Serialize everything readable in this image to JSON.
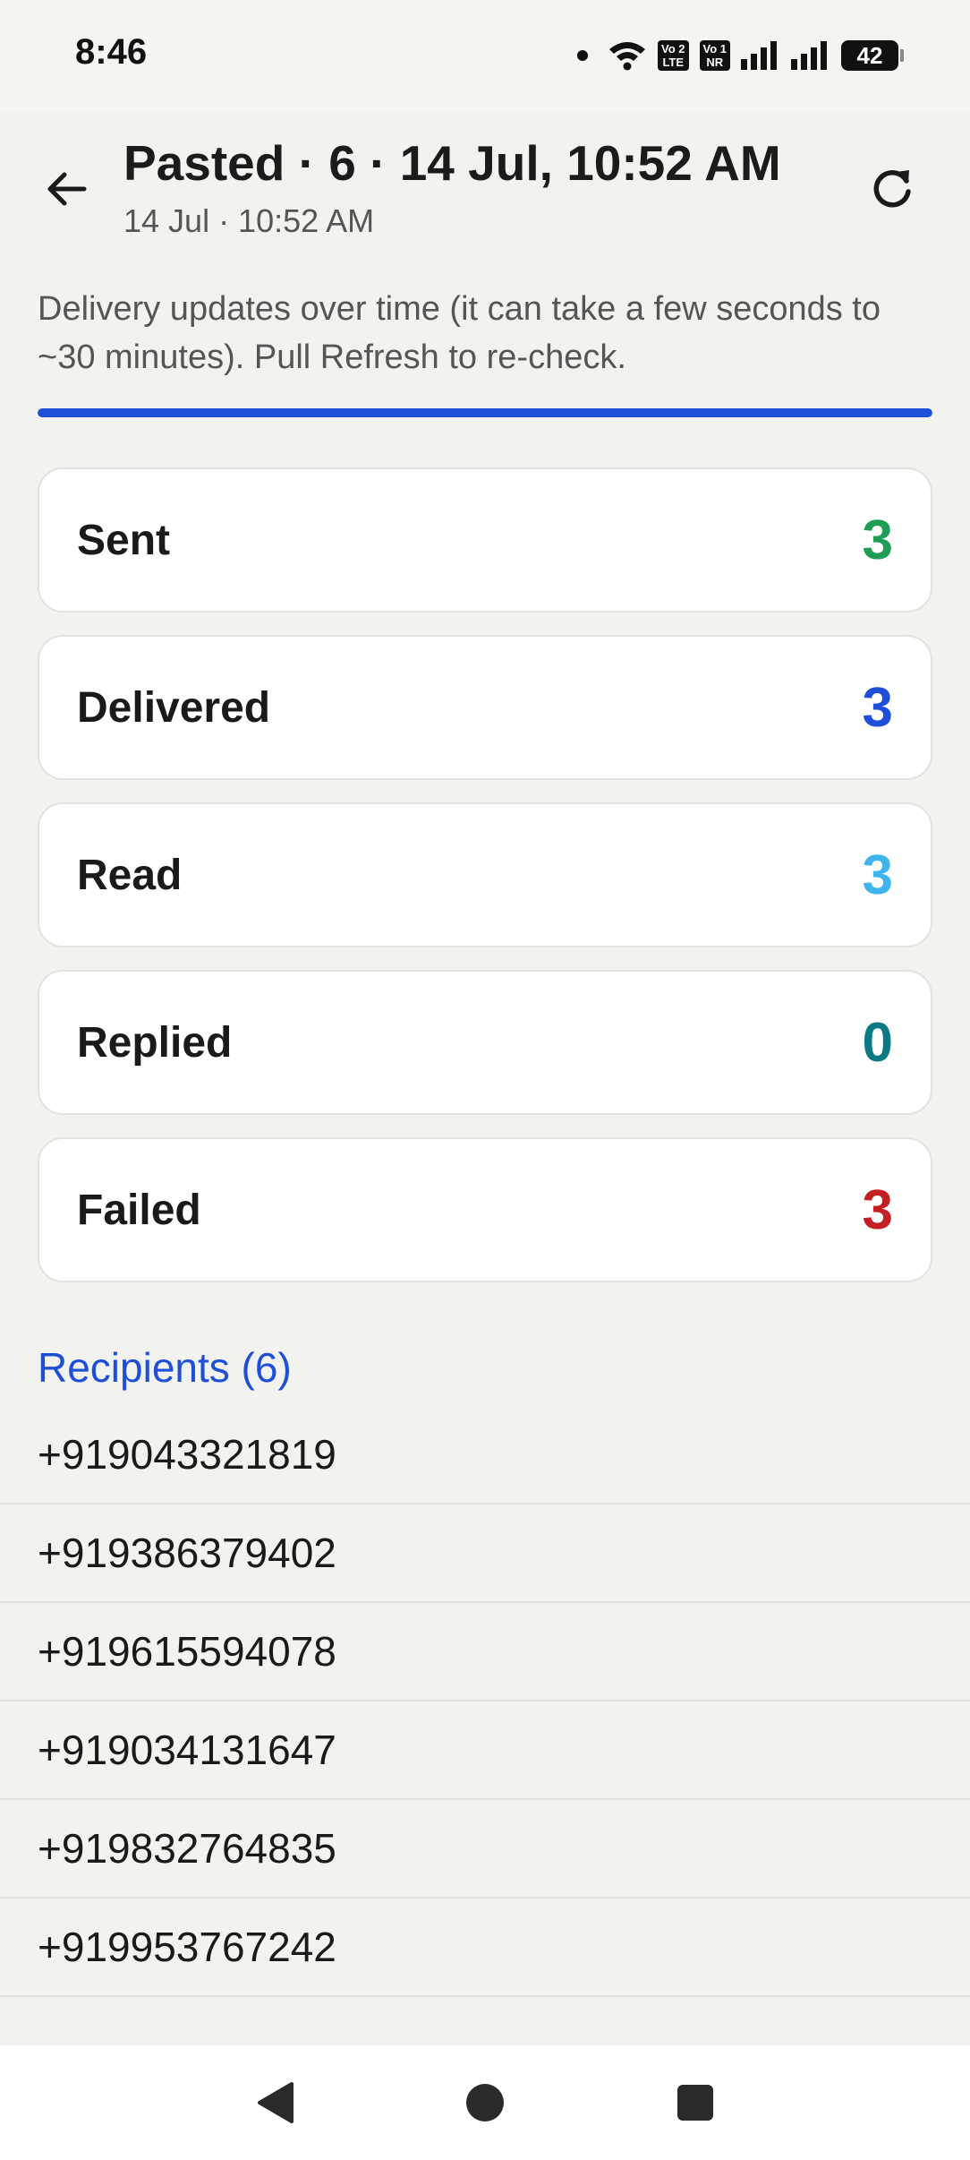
{
  "status_bar": {
    "time": "8:46",
    "network_1": {
      "top": "Vo 2",
      "bottom": "LTE"
    },
    "network_2": {
      "top": "Vo 1",
      "bottom": "NR"
    },
    "battery": "42"
  },
  "header": {
    "title": "Pasted · 6 · 14 Jul, 10:52 AM",
    "subtitle": "14 Jul · 10:52 AM"
  },
  "info": {
    "text": "Delivery updates over time (it can take a few seconds to ~30 minutes). Pull Refresh to re-check.",
    "progress_percent": 100
  },
  "stats": [
    {
      "label": "Sent",
      "value": "3",
      "color": "#1f9d55"
    },
    {
      "label": "Delivered",
      "value": "3",
      "color": "#1e4fd8"
    },
    {
      "label": "Read",
      "value": "3",
      "color": "#3db4ec"
    },
    {
      "label": "Replied",
      "value": "0",
      "color": "#0b7a85"
    },
    {
      "label": "Failed",
      "value": "3",
      "color": "#c41f25"
    }
  ],
  "recipients": {
    "title": "Recipients (6)",
    "items": [
      "+919043321819",
      "+919386379402",
      "+919615594078",
      "+919034131647",
      "+919832764835",
      "+919953767242"
    ]
  },
  "icons": {
    "back": "arrow-left-icon",
    "refresh": "refresh-icon",
    "nav_back": "triangle-back-icon",
    "nav_home": "circle-home-icon",
    "nav_recent": "square-recent-icon"
  }
}
